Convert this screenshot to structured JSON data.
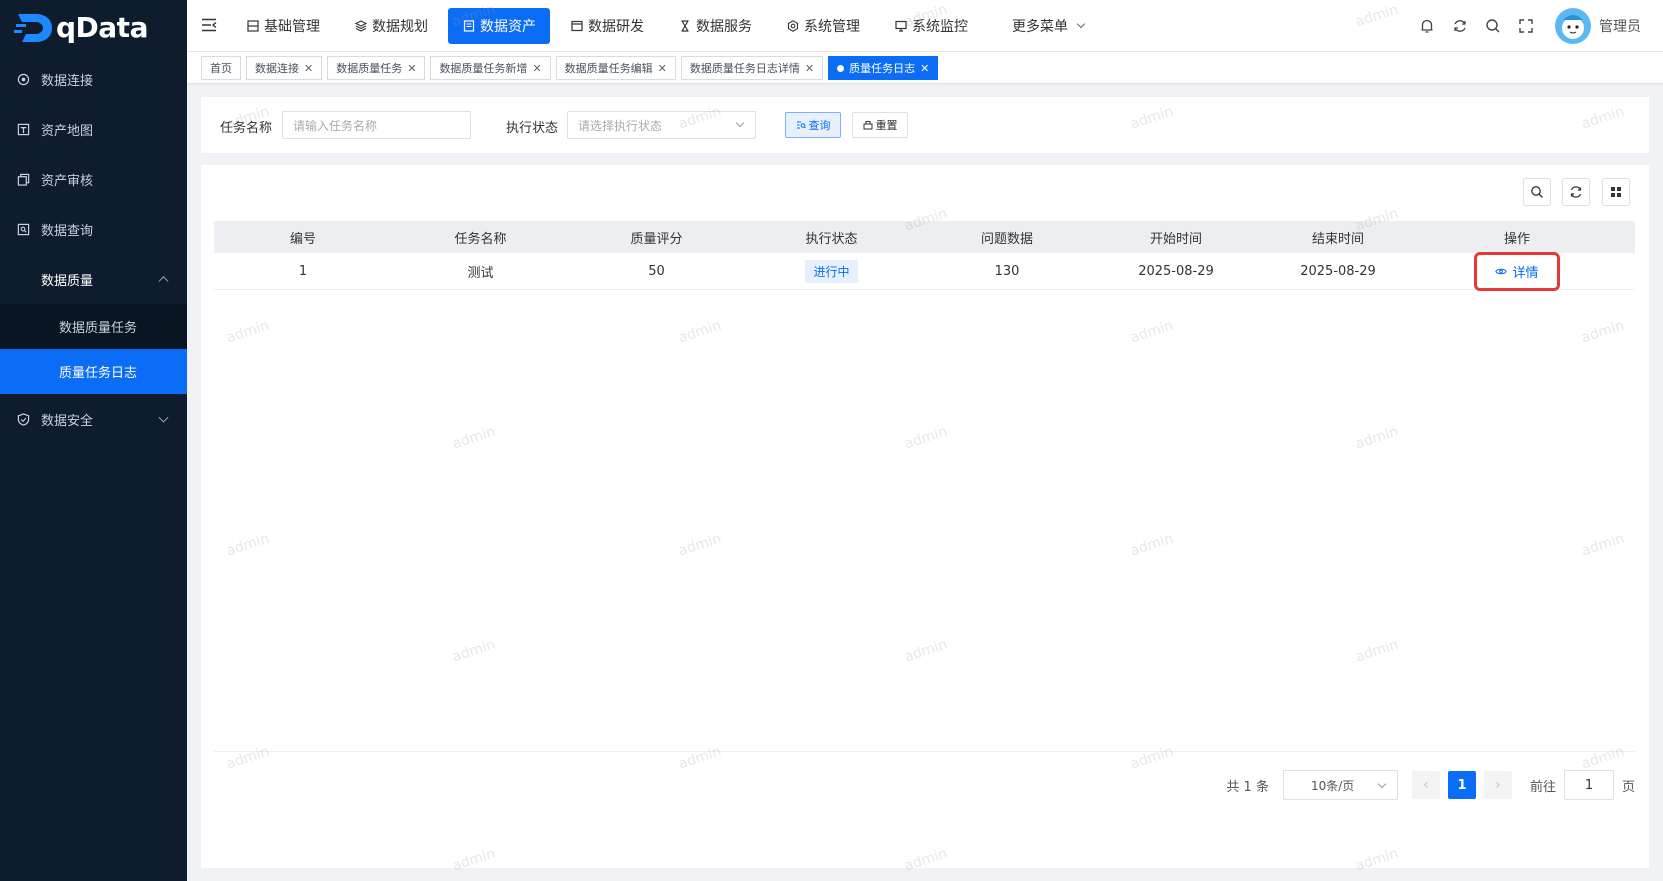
{
  "app": {
    "logo_text": "qData"
  },
  "sidebar": {
    "items": [
      {
        "label": "数据连接",
        "icon": "target-icon"
      },
      {
        "label": "资产地图",
        "icon": "map-icon"
      },
      {
        "label": "资产审核",
        "icon": "copy-icon"
      },
      {
        "label": "数据查询",
        "icon": "query-icon"
      }
    ],
    "group_quality": {
      "label": "数据质量",
      "expanded": true,
      "children": [
        "数据质量任务",
        "质量任务日志"
      ],
      "active_child": "质量任务日志"
    },
    "group_security": {
      "label": "数据安全",
      "expanded": false
    }
  },
  "topnav": {
    "items": [
      "基础管理",
      "数据规划",
      "数据资产",
      "数据研发",
      "数据服务",
      "系统管理",
      "系统监控",
      "更多菜单"
    ],
    "active": "数据资产"
  },
  "user": {
    "name": "管理员"
  },
  "tabs": [
    "首页",
    "数据连接",
    "数据质量任务",
    "数据质量任务新增",
    "数据质量任务编辑",
    "数据质量任务日志详情",
    "质量任务日志"
  ],
  "search": {
    "task_name_label": "任务名称",
    "task_name_placeholder": "请输入任务名称",
    "status_label": "执行状态",
    "status_placeholder": "请选择执行状态",
    "query_button": "查询",
    "reset_button": "重置"
  },
  "table": {
    "columns": [
      "编号",
      "任务名称",
      "质量评分",
      "执行状态",
      "问题数据",
      "开始时间",
      "结束时间",
      "操作"
    ],
    "rows": [
      {
        "id": "1",
        "name": "测试",
        "score": "50",
        "status": "进行中",
        "issues": "130",
        "start": "2025-08-29",
        "end": "2025-08-29",
        "action": "详情"
      }
    ]
  },
  "pagination": {
    "total": "共 1 条",
    "page_size": "10条/页",
    "current_page": "1",
    "goto_label": "前往",
    "goto_value": "1",
    "goto_unit": "页"
  },
  "watermark": "admin",
  "colors": {
    "primary": "#0b6cf5",
    "sidebar_bg": "#0f1c2e",
    "highlight": "#e53935"
  }
}
